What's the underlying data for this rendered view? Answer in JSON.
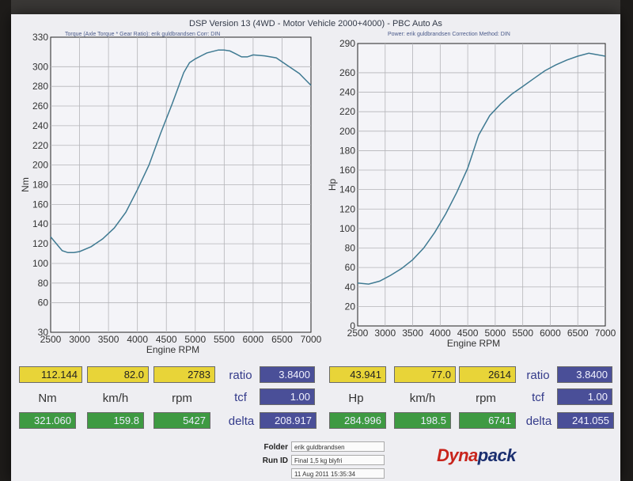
{
  "header": {
    "title": "DSP Version 13 (4WD - Motor Vehicle 2000+4000) - PBC Auto As",
    "left_sub": "Torque (Axle Torque * Gear Ratio): erik guldbrandsen      Corr: DIN",
    "right_sub": "Power: erik guldbrandsen      Correction Method: DIN"
  },
  "chart_data": [
    {
      "type": "line",
      "xlabel": "Engine RPM",
      "ylabel": "Nm",
      "xlim": [
        2500,
        7000
      ],
      "ylim": [
        30,
        330
      ],
      "xticks": [
        "2500",
        "3000",
        "3500",
        "4000",
        "4500",
        "5000",
        "5500",
        "6000",
        "6500",
        "7000"
      ],
      "yticks": [
        "330",
        "300",
        "280",
        "260",
        "240",
        "220",
        "200",
        "180",
        "160",
        "140",
        "120",
        "100",
        "80",
        "60",
        "30"
      ],
      "grid": true,
      "color": "#3f7a92",
      "x": [
        2500,
        2600,
        2700,
        2800,
        2900,
        3000,
        3200,
        3400,
        3600,
        3800,
        4000,
        4200,
        4400,
        4600,
        4800,
        4900,
        5000,
        5200,
        5400,
        5500,
        5600,
        5700,
        5800,
        5900,
        6000,
        6200,
        6400,
        6600,
        6800,
        7000
      ],
      "y": [
        127,
        120,
        113,
        111,
        111,
        112,
        117,
        125,
        136,
        152,
        175,
        200,
        232,
        262,
        294,
        304,
        308,
        314,
        317,
        317,
        316,
        313,
        310,
        310,
        312,
        311,
        309,
        301,
        293,
        281
      ]
    },
    {
      "type": "line",
      "xlabel": "Engine RPM",
      "ylabel": "Hp",
      "xlim": [
        2500,
        7000
      ],
      "ylim": [
        0,
        290
      ],
      "xticks": [
        "2500",
        "3000",
        "3500",
        "4000",
        "4500",
        "5000",
        "5500",
        "6000",
        "6500",
        "7000"
      ],
      "yticks": [
        "290",
        "260",
        "240",
        "220",
        "200",
        "180",
        "160",
        "140",
        "120",
        "100",
        "80",
        "60",
        "40",
        "20",
        "0"
      ],
      "grid": true,
      "color": "#3f7a92",
      "x": [
        2500,
        2700,
        2900,
        3100,
        3300,
        3500,
        3700,
        3900,
        4100,
        4300,
        4500,
        4700,
        4900,
        5100,
        5300,
        5500,
        5700,
        5900,
        6100,
        6300,
        6500,
        6700,
        6800,
        7000
      ],
      "y": [
        44,
        43,
        46,
        52,
        59,
        68,
        80,
        96,
        115,
        137,
        162,
        196,
        216,
        228,
        238,
        246,
        254,
        262,
        268,
        273,
        277,
        280,
        279,
        277
      ]
    }
  ],
  "bottom": {
    "left": {
      "row1": [
        "112.144",
        "82.0",
        "2783"
      ],
      "labels": [
        "Nm",
        "km/h",
        "rpm"
      ],
      "row3": [
        "321.060",
        "159.8",
        "5427"
      ],
      "ratio_label": "ratio",
      "ratio_value": "3.8400",
      "tcf_label": "tcf",
      "tcf_value": "1.00",
      "delta_label": "delta",
      "delta_value": "208.917"
    },
    "right": {
      "row1": [
        "43.941",
        "77.0",
        "2614"
      ],
      "labels": [
        "Hp",
        "km/h",
        "rpm"
      ],
      "row3": [
        "284.996",
        "198.5",
        "6741"
      ],
      "ratio_label": "ratio",
      "ratio_value": "3.8400",
      "tcf_label": "tcf",
      "tcf_value": "1.00",
      "delta_label": "delta",
      "delta_value": "241.055"
    }
  },
  "meta": {
    "folder_label": "Folder",
    "folder_value": "erik guldbrandsen",
    "runid_label": "Run ID",
    "runid_value": "Final 1,5 kg blyfri",
    "date_value": "11 Aug 2011 15:35:34"
  },
  "logo": {
    "part1": "Dyna",
    "part2": "pack"
  }
}
